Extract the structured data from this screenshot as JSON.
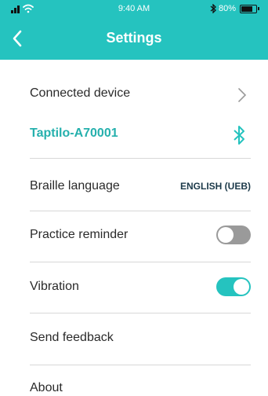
{
  "status_bar": {
    "time": "9:40 AM",
    "battery": "80%",
    "battery_level": 0.8,
    "icons": [
      "signal-icon",
      "wifi-icon",
      "bluetooth-icon",
      "battery-icon"
    ]
  },
  "app_bar": {
    "title": "Settings",
    "back_icon": "back-chevron-icon",
    "color": "#25c3bf"
  },
  "settings": {
    "connected_device": {
      "label": "Connected device"
    },
    "device": {
      "name": "Taptilo-A70001"
    },
    "braille_language": {
      "label": "Braille language",
      "value": "ENGLISH (UEB)"
    },
    "practice_reminder": {
      "label": "Practice reminder",
      "enabled": false
    },
    "vibration": {
      "label": "Vibration",
      "enabled": true
    },
    "send_feedback": {
      "label": "Send feedback"
    },
    "about": {
      "label": "About"
    }
  },
  "colors": {
    "accent": "#25c3bf",
    "toggle_off": "#9a9a9a",
    "divider": "#d8d8d8"
  }
}
